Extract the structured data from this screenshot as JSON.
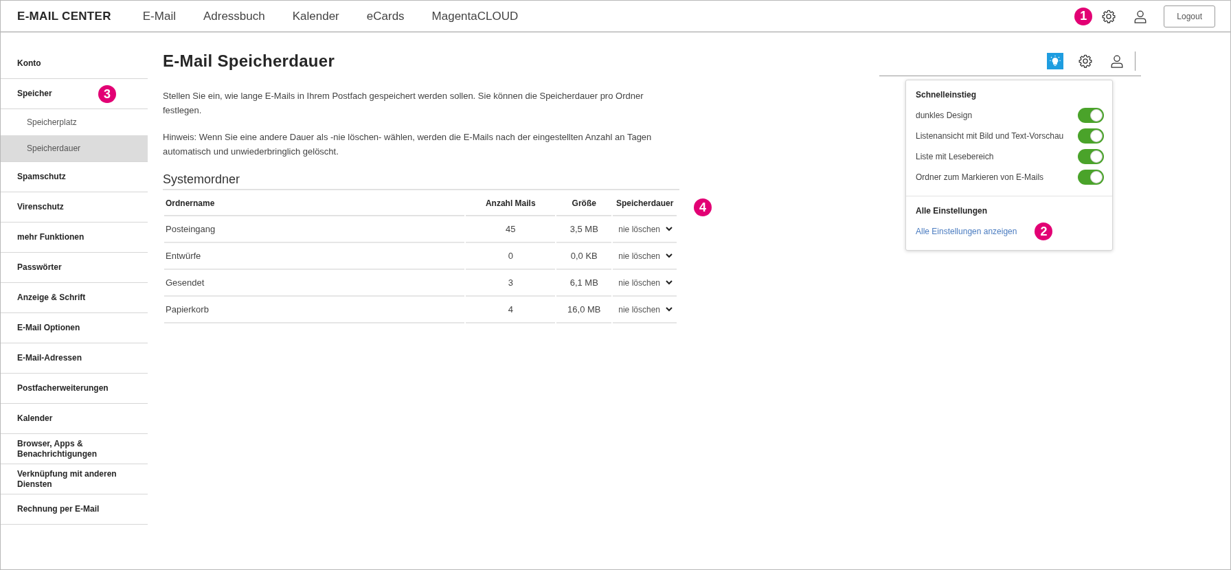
{
  "header": {
    "brand": "E-MAIL CENTER",
    "nav": [
      {
        "label": "E-Mail"
      },
      {
        "label": "Adressbuch"
      },
      {
        "label": "Kalender"
      },
      {
        "label": "eCards"
      },
      {
        "label": "MagentaCLOUD"
      }
    ],
    "marker": "1",
    "logout": "Logout"
  },
  "sidebar": {
    "items": [
      {
        "label": "Konto",
        "selected": false
      },
      {
        "label": "Speicher",
        "selected": false,
        "marker": "3",
        "children": [
          {
            "label": "Speicherplatz",
            "selected": false
          },
          {
            "label": "Speicherdauer",
            "selected": true
          }
        ]
      },
      {
        "label": "Spamschutz",
        "selected": false
      },
      {
        "label": "Virenschutz",
        "selected": false
      },
      {
        "label": "mehr Funktionen",
        "selected": false
      },
      {
        "label": "Passwörter",
        "selected": false
      },
      {
        "label": "Anzeige & Schrift",
        "selected": false
      },
      {
        "label": "E-Mail Optionen",
        "selected": false
      },
      {
        "label": "E-Mail-Adressen",
        "selected": false
      },
      {
        "label": "Postfacherweiterungen",
        "selected": false
      },
      {
        "label": "Kalender",
        "selected": false
      },
      {
        "label": "Browser, Apps & Benachrichtigungen",
        "selected": false
      },
      {
        "label": "Verknüpfung mit anderen Diensten",
        "selected": false
      },
      {
        "label": "Rechnung per E-Mail",
        "selected": false
      }
    ]
  },
  "page": {
    "title": "E-Mail Speicherdauer",
    "paragraphs": [
      "Stellen Sie ein, wie lange E-Mails in Ihrem Postfach gespeichert werden sollen. Sie können die Speicherdauer pro Ordner festlegen.",
      "Hinweis: Wenn Sie eine andere Dauer als -nie löschen- wählen, werden die E-Mails nach der eingestellten Anzahl an Tagen automatisch und unwiederbringlich gelöscht."
    ],
    "section_title": "Systemordner",
    "table": {
      "columns": [
        "Ordnername",
        "Anzahl Mails",
        "Größe",
        "Speicherdauer"
      ],
      "marker": "4",
      "rows": [
        {
          "name": "Posteingang",
          "count": "45",
          "size": "3,5 MB",
          "duration": "nie löschen"
        },
        {
          "name": "Entwürfe",
          "count": "0",
          "size": "0,0 KB",
          "duration": "nie löschen"
        },
        {
          "name": "Gesendet",
          "count": "3",
          "size": "6,1 MB",
          "duration": "nie löschen"
        },
        {
          "name": "Papierkorb",
          "count": "4",
          "size": "16,0 MB",
          "duration": "nie löschen"
        }
      ]
    }
  },
  "toolbar": {
    "tips_active": true
  },
  "quick_panel": {
    "title": "Schnelleinstieg",
    "toggles": [
      {
        "label": "dunkles Design",
        "on": true
      },
      {
        "label": "Listenansicht mit Bild und Text-Vorschau",
        "on": true
      },
      {
        "label": "Liste mit Lesebereich",
        "on": true
      },
      {
        "label": "Ordner zum Markieren von E-Mails",
        "on": true
      }
    ],
    "section_title": "Alle Einstellungen",
    "link": "Alle Einstellungen anzeigen",
    "marker": "2"
  }
}
